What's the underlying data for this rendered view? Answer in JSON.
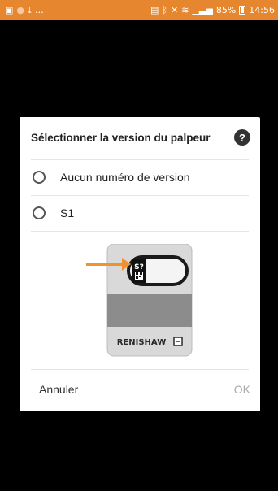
{
  "status_bar": {
    "battery_percent": "85%",
    "time": "14:56",
    "left_icons": [
      "image-icon",
      "notification-dot-icon",
      "download-icon",
      "more-icon"
    ],
    "right_icons": [
      "sim-icon",
      "bluetooth-icon",
      "mute-icon",
      "wifi-icon",
      "signal-icon",
      "battery-icon"
    ]
  },
  "dialog": {
    "title": "Sélectionner la version du palpeur",
    "help_icon_glyph": "?",
    "options": [
      {
        "label": "Aucun numéro de version",
        "selected": false
      },
      {
        "label": "S1",
        "selected": false
      }
    ],
    "image": {
      "version_badge": "S?",
      "brand": "RENISHAW"
    },
    "cancel_label": "Annuler",
    "ok_label": "OK"
  },
  "colors": {
    "status_bar": "#e6872f",
    "arrow": "#f0922e",
    "probe_body": "#d9d9d9",
    "probe_band": "#8c8c8c"
  }
}
